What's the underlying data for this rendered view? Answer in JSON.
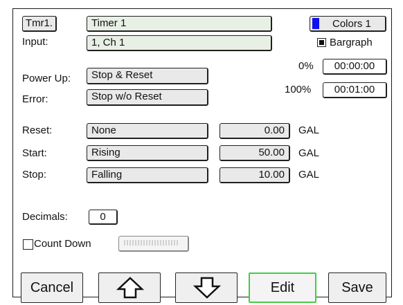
{
  "timer": {
    "tag": "Tmr1.",
    "name": "Timer 1"
  },
  "colors": {
    "label": "Colors 1",
    "swatch_color": "#1010ee"
  },
  "input": {
    "label": "Input:",
    "value": "1, Ch 1"
  },
  "bargraph": {
    "label": "Bargraph",
    "checked": true
  },
  "scale": {
    "low_label": "0%",
    "low_value": "00:00:00",
    "high_label": "100%",
    "high_value": "00:01:00"
  },
  "power_up": {
    "label": "Power Up:",
    "value": "Stop & Reset"
  },
  "error": {
    "label": "Error:",
    "value": "Stop w/o Reset"
  },
  "rows": [
    {
      "label": "Reset:",
      "mode": "None",
      "value": "0.00",
      "unit": "GAL"
    },
    {
      "label": "Start:",
      "mode": "Rising",
      "value": "50.00",
      "unit": "GAL"
    },
    {
      "label": "Stop:",
      "mode": "Falling",
      "value": "10.00",
      "unit": "GAL"
    }
  ],
  "decimals": {
    "label": "Decimals:",
    "value": "0"
  },
  "count_down": {
    "label": "Count Down",
    "checked": false
  },
  "buttons": {
    "cancel": "Cancel",
    "edit": "Edit",
    "save": "Save"
  },
  "icons": {
    "up": "up-arrow-icon",
    "down": "down-arrow-icon"
  }
}
